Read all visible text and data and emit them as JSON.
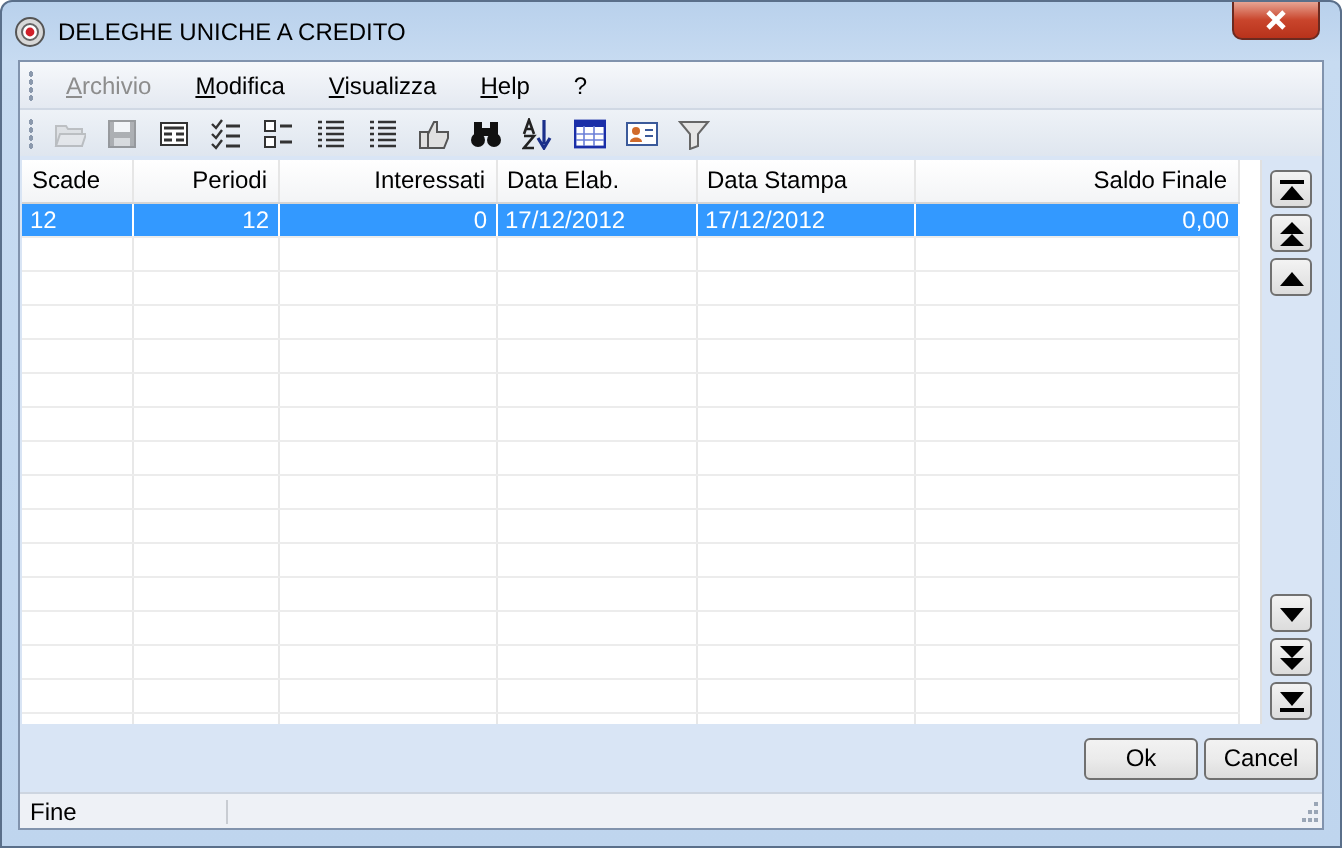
{
  "window": {
    "title": "DELEGHE UNICHE A CREDITO"
  },
  "menu": [
    {
      "label": "Archivio",
      "disabled": true
    },
    {
      "label": "Modifica",
      "disabled": false
    },
    {
      "label": "Visualizza",
      "disabled": false
    },
    {
      "label": "Help",
      "disabled": false
    },
    {
      "label": "?",
      "disabled": false
    }
  ],
  "toolbar": [
    {
      "kind": "open",
      "disabled": true
    },
    {
      "kind": "save",
      "disabled": true
    },
    {
      "kind": "form",
      "disabled": false
    },
    {
      "kind": "checklist",
      "disabled": false
    },
    {
      "kind": "boxlist",
      "disabled": false
    },
    {
      "kind": "list",
      "disabled": false
    },
    {
      "kind": "list",
      "disabled": false
    },
    {
      "kind": "thumb",
      "disabled": false
    },
    {
      "kind": "binoculars",
      "disabled": false
    },
    {
      "kind": "sort",
      "disabled": false
    },
    {
      "kind": "grid",
      "disabled": false
    },
    {
      "kind": "card",
      "disabled": false
    },
    {
      "kind": "filter",
      "disabled": false
    }
  ],
  "table": {
    "columns": [
      {
        "label": "Scade"
      },
      {
        "label": "Periodi"
      },
      {
        "label": "Interessati"
      },
      {
        "label": "Data Elab."
      },
      {
        "label": "Data Stampa"
      },
      {
        "label": "Saldo Finale"
      }
    ],
    "rows": [
      {
        "selected": true,
        "cells": [
          "12",
          "12",
          "0",
          "17/12/2012",
          "17/12/2012",
          "0,00"
        ]
      }
    ]
  },
  "nav_buttons": [
    {
      "kind": "first"
    },
    {
      "kind": "page-up"
    },
    {
      "kind": "up"
    },
    {
      "kind": "down"
    },
    {
      "kind": "page-down"
    },
    {
      "kind": "last"
    }
  ],
  "buttons": [
    {
      "label": "Ok"
    },
    {
      "label": "Cancel"
    }
  ],
  "status_bar": {
    "text": "Fine"
  }
}
